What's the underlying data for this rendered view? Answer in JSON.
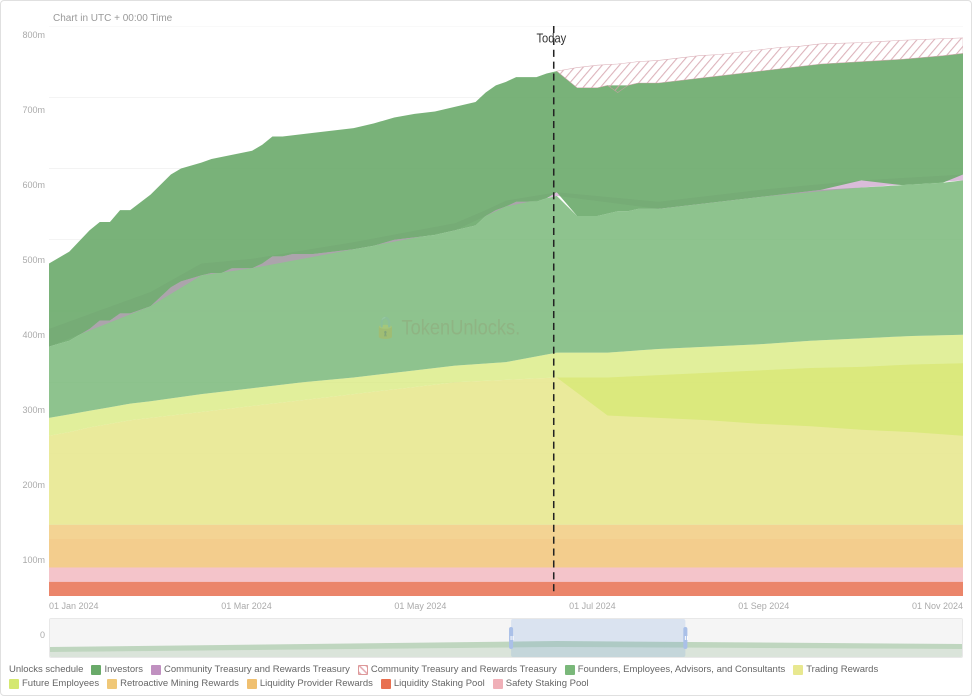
{
  "chart": {
    "title": "Chart in UTC + 00:00 Time",
    "today_label": "Today",
    "y_labels": [
      "0",
      "100m",
      "200m",
      "300m",
      "400m",
      "500m",
      "600m",
      "700m",
      "800m"
    ],
    "x_labels": [
      "01 Jan 2024",
      "01 Mar 2024",
      "01 May 2024",
      "01 Jul 2024",
      "01 Sep 2024",
      "01 Nov 2024"
    ],
    "watermark": "TokenUnlocks."
  },
  "legend": {
    "unlocks_schedule_label": "Unlocks schedule",
    "investors_label": "Investors",
    "community_treasury_label": "Community Treasury and Rewards Treasury",
    "community_treasury_hatched_label": "Community Treasury and Rewards Treasury",
    "founders_label": "Founders, Employees, Advisors, and Consultants",
    "trading_rewards_label": "Trading Rewards",
    "future_employees_label": "Future Employees",
    "retroactive_label": "Retroactive Mining Rewards",
    "liquidity_provider_label": "Liquidity Provider Rewards",
    "liquidity_staking_label": "Liquidity Staking Pool",
    "safety_staking_label": "Safety Staking Pool"
  },
  "colors": {
    "investors": "#5a9e5a",
    "community_treasury": "#b06cb0",
    "community_treasury_hatched": "#e8b4bc",
    "founders": "#8dc48d",
    "trading_rewards": "#e8e888",
    "future_employees": "#c8e060",
    "retroactive": "#f0c878",
    "liquidity_provider": "#e8a050",
    "liquidity_staking": "#e05030",
    "safety_staking": "#f0c0c8"
  }
}
